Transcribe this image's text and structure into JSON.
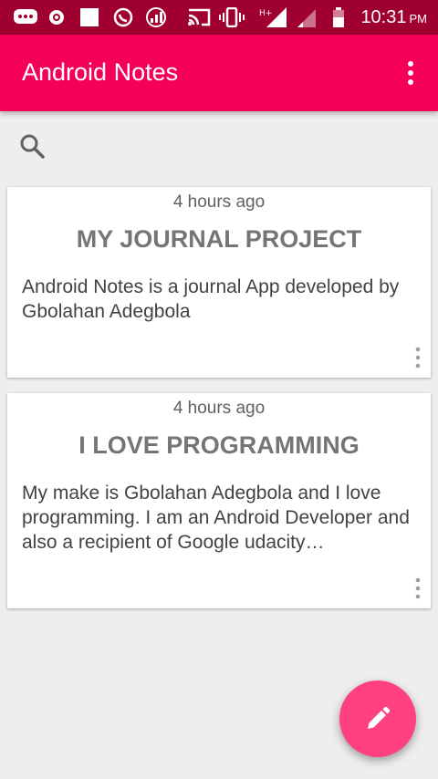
{
  "status_bar": {
    "time": "10:31",
    "ampm": "PM",
    "icons": [
      "chat-notification-icon",
      "target-icon",
      "square-icon",
      "whatsapp-icon",
      "data-usage-icon",
      "cast-icon",
      "vibrate-icon",
      "hplus-signal-icon",
      "signal-icon",
      "battery-icon"
    ]
  },
  "app_bar": {
    "title": "Android Notes",
    "menu_icon": "more-vert-icon"
  },
  "search": {
    "icon": "search-icon"
  },
  "notes": [
    {
      "time": "4 hours ago",
      "title": "MY JOURNAL PROJECT",
      "body": "Android Notes is a journal App developed by Gbolahan Adegbola"
    },
    {
      "time": "4 hours ago",
      "title": "I LOVE PROGRAMMING",
      "body": "My make is Gbolahan Adegbola and I love programming. I am an Android Developer and also a recipient of Google udacity…"
    }
  ],
  "fab": {
    "icon": "pencil-icon"
  },
  "colors": {
    "status_bar": "#a0002f",
    "app_bar": "#f50057",
    "fab": "#ff4081",
    "background": "#eeeeee"
  }
}
